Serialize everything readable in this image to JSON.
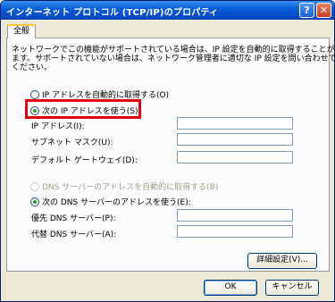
{
  "window": {
    "title": "インターネット プロトコル (TCP/IP)のプロパティ",
    "help_symbol": "?",
    "close_symbol": "✕"
  },
  "tabs": [
    {
      "label": "全般"
    }
  ],
  "description": [
    "ネットワークでこの機能がサポートされている場合は、IP 設定を自動的に取得することができ",
    "ます。サポートされていない場合は、ネットワーク管理者に適切な IP 設定を問い合わせて",
    "ください。"
  ],
  "ip": {
    "auto_label": "IP アドレスを自動的に取得する(O)",
    "manual_label": "次の IP アドレスを使う(S):",
    "selected": "manual",
    "fields": {
      "ip_address_label": "IP アドレス(I):",
      "subnet_label": "サブネット マスク(U):",
      "gateway_label": "デフォルト ゲートウェイ(D):",
      "ip_address_value": "",
      "subnet_value": "",
      "gateway_value": ""
    }
  },
  "dns": {
    "auto_label": "DNS サーバーのアドレスを自動的に取得する(B)",
    "manual_label": "次の DNS サーバーのアドレスを使う(E):",
    "selected": "manual",
    "preferred_label": "優先 DNS サーバー(P):",
    "alternate_label": "代替 DNS サーバー(A):",
    "preferred_value": "",
    "alternate_value": ""
  },
  "buttons": {
    "advanced": "詳細設定(V)...",
    "ok": "OK",
    "cancel": "キャンセル"
  },
  "colors": {
    "highlight": "#e3000f",
    "titlebar": "#0a5fd8"
  }
}
